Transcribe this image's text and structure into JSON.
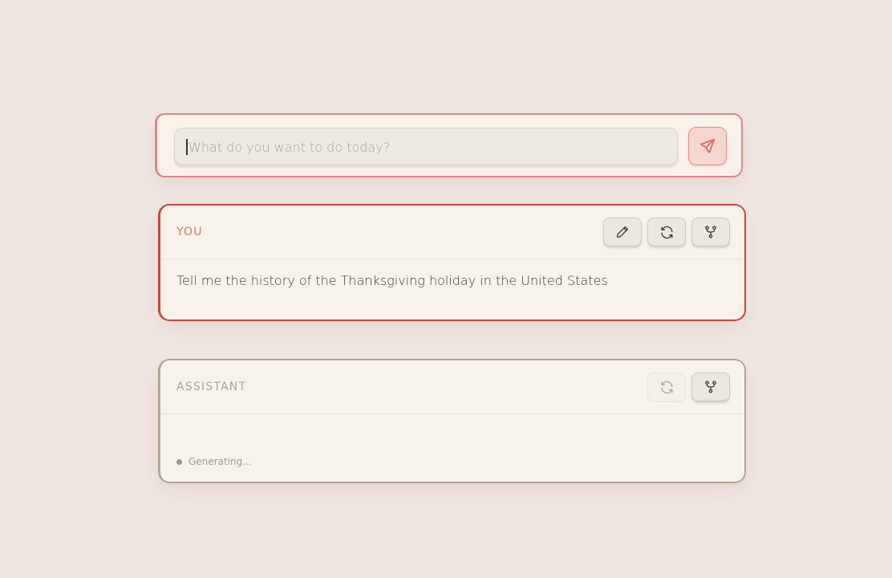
{
  "composer": {
    "placeholder": "What do you want to do today?",
    "value": "",
    "send_icon": "send-icon"
  },
  "messages": [
    {
      "role_label": "YOU",
      "text": "Tell me the history of the Thanksgiving holiday in the United States",
      "actions": [
        "edit-icon",
        "refresh-icon",
        "branch-icon"
      ]
    },
    {
      "role_label": "ASSISTANT",
      "status": "Generating...",
      "actions": [
        "refresh-icon",
        "branch-icon"
      ]
    }
  ],
  "colors": {
    "background": "#f1e7e2",
    "user_accent": "#c8453d",
    "input_accent": "#e2857f",
    "assistant_border": "#b7a391"
  }
}
